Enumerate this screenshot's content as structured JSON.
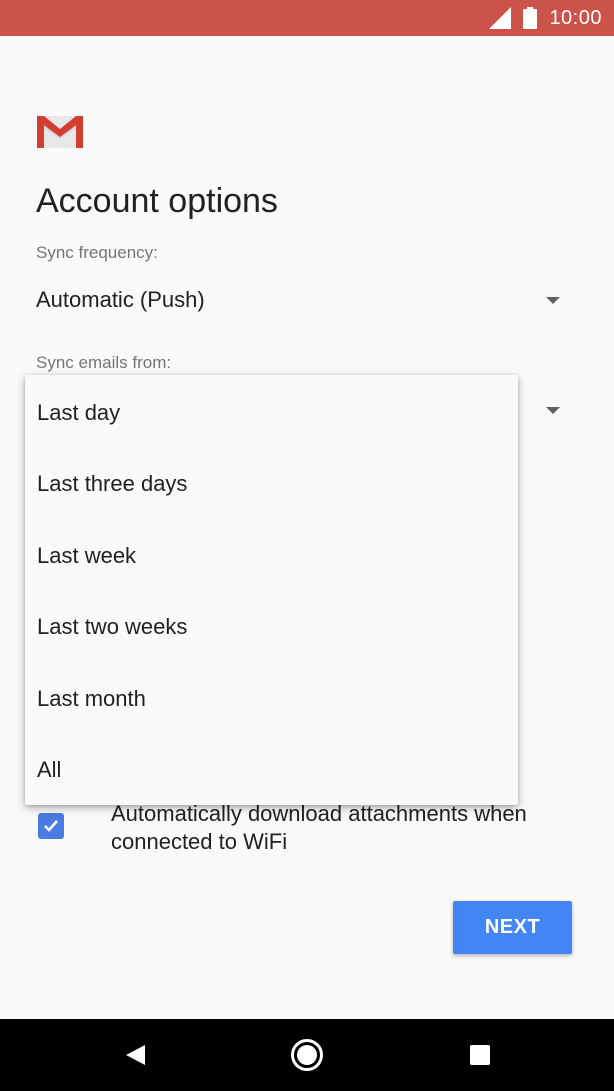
{
  "status_bar": {
    "time": "10:00",
    "signal_icon": "cell-signal-icon",
    "battery_icon": "battery-icon"
  },
  "app": {
    "logo_icon": "gmail-logo-icon"
  },
  "page": {
    "title": "Account options"
  },
  "sync_frequency": {
    "label": "Sync frequency:",
    "value": "Automatic (Push)"
  },
  "sync_emails_from": {
    "label": "Sync emails from:",
    "options": [
      "Last day",
      "Last three days",
      "Last week",
      "Last two weeks",
      "Last month",
      "All"
    ]
  },
  "attachments": {
    "label": "Automatically download attachments when connected to WiFi",
    "checked": true
  },
  "actions": {
    "next_label": "NEXT"
  },
  "colors": {
    "status_bar": "#cc5349",
    "accent": "#4285f4",
    "checkbox": "#4a7be0"
  }
}
